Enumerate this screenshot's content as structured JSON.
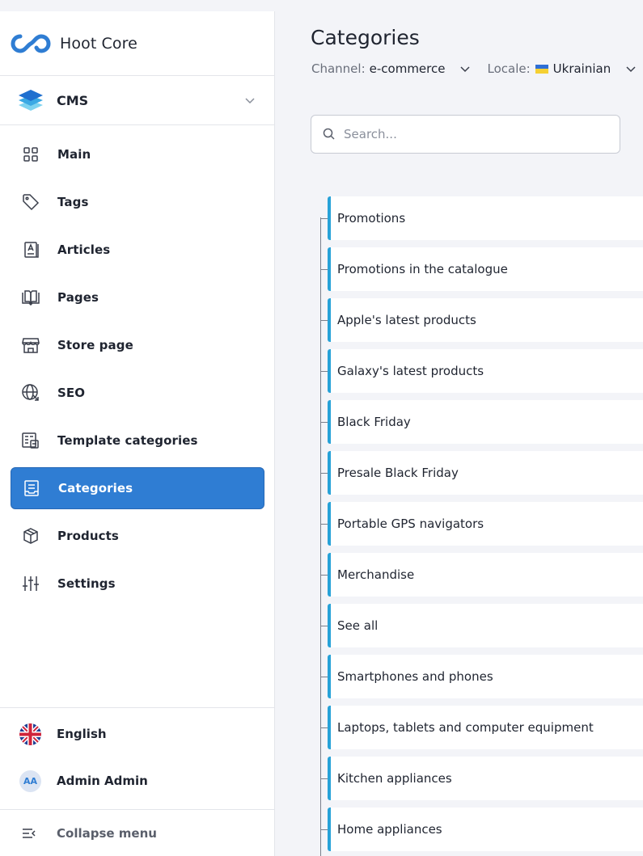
{
  "app": {
    "title": "Hoot Core"
  },
  "module": {
    "label": "CMS"
  },
  "sidebar": {
    "items": [
      {
        "label": "Main",
        "icon": "grid-icon"
      },
      {
        "label": "Tags",
        "icon": "tag-icon"
      },
      {
        "label": "Articles",
        "icon": "article-icon"
      },
      {
        "label": "Pages",
        "icon": "book-icon"
      },
      {
        "label": "Store page",
        "icon": "store-icon"
      },
      {
        "label": "SEO",
        "icon": "globe-icon"
      },
      {
        "label": "Template categories",
        "icon": "template-icon"
      },
      {
        "label": "Categories",
        "icon": "categories-icon",
        "active": true
      },
      {
        "label": "Products",
        "icon": "box-icon"
      },
      {
        "label": "Settings",
        "icon": "sliders-icon"
      }
    ],
    "language": "English",
    "user": {
      "initials": "AA",
      "name": "Admin Admin"
    },
    "collapse_label": "Collapse menu"
  },
  "main": {
    "title": "Categories",
    "channel": {
      "label": "Channel:",
      "value": "e-commerce"
    },
    "locale": {
      "label": "Locale:",
      "value": "Ukrainian"
    },
    "search": {
      "placeholder": "Search..."
    },
    "categories": [
      "Promotions",
      "Promotions in the catalogue",
      "Apple's latest products",
      "Galaxy's latest products",
      "Black Friday",
      "Presale Black Friday",
      "Portable GPS navigators",
      "Merchandise",
      "See all",
      "Smartphones and phones",
      "Laptops, tablets and computer equipment",
      "Kitchen appliances",
      "Home appliances"
    ]
  },
  "colors": {
    "accent": "#2f7dd3",
    "tree_marker": "#27a2d8",
    "background": "#f3f4f8"
  }
}
